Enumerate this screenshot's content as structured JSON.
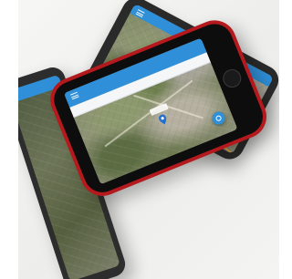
{
  "scene": {
    "background": "#f1f1ef"
  },
  "phones": [
    {
      "name": "front-phone",
      "frame_color": "#b3191d",
      "appbar_color": "#2f8fd8",
      "appbar_title": "",
      "search_placeholder": ""
    },
    {
      "name": "back-right-phone",
      "frame_color": "#2a2a2a",
      "appbar_color": "#2f8fd8"
    },
    {
      "name": "left-partial-phone",
      "frame_color": "#2d2d2d",
      "appbar_color": "#2f8fd8"
    }
  ],
  "map": {
    "pin_color": "#1e6fd0",
    "locate_button_color": "#2f8fd8",
    "route_color": "#e8a23a"
  }
}
